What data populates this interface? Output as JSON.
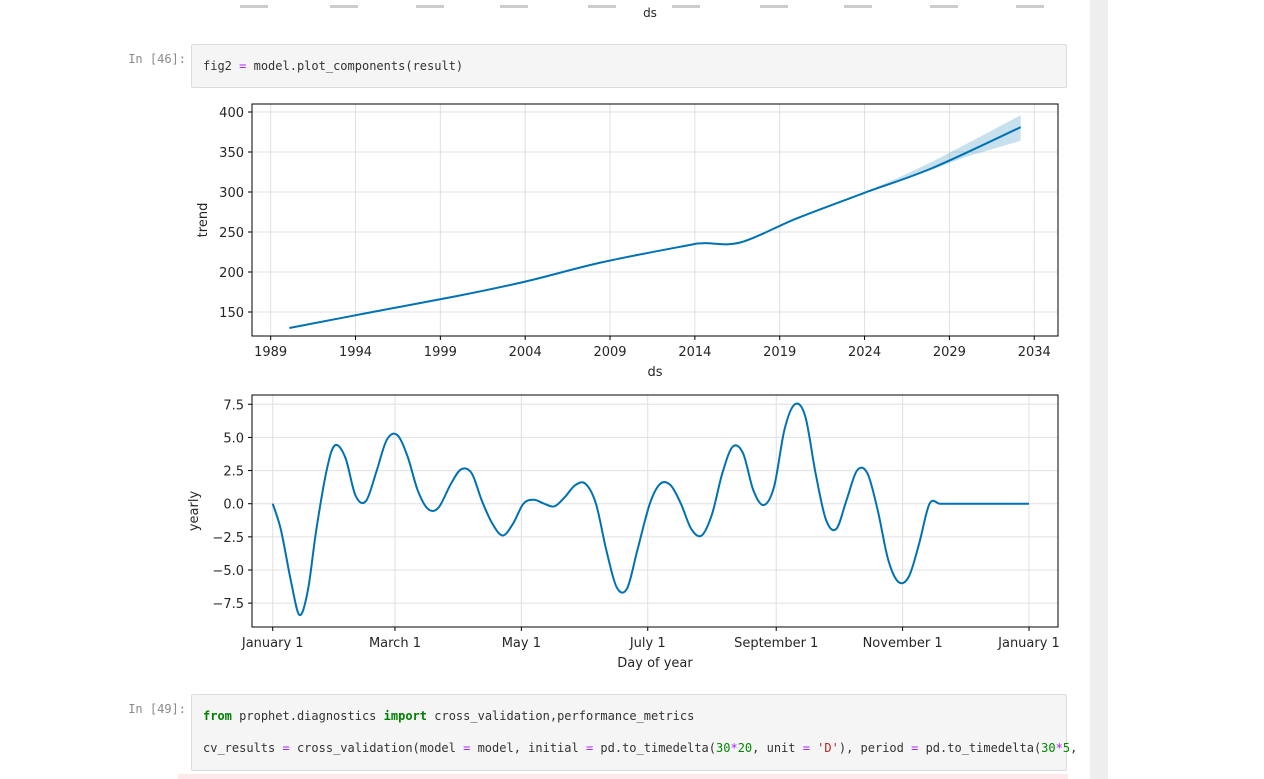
{
  "top_fragment": {
    "xlabel": "ds"
  },
  "cells": [
    {
      "prompt": "In [46]:",
      "code": {
        "var": "fig2",
        "eq": "=",
        "call": "model.plot_components",
        "paren_open": "(",
        "arg": "result",
        "paren_close": ")"
      }
    },
    {
      "prompt": "In [49]:",
      "line1": {
        "from": "from",
        "module": "prophet.diagnostics",
        "import": "import",
        "names": "cross_validation,performance_metrics"
      },
      "line2": {
        "t1": "cv_results ",
        "eq1": "=",
        "t2": " cross_validation(model ",
        "eq2": "=",
        "t3": " model, initial ",
        "eq3": "=",
        "t4": " pd.to_timedelta(",
        "n1": "30",
        "op1": "*",
        "n2": "20",
        "t5": ", unit ",
        "eq4": "=",
        "s1": " 'D'",
        "t6": "), period ",
        "eq5": "=",
        "t7": " pd.to_timedelta(",
        "n3": "30",
        "op2": "*",
        "n4": "5",
        "t8": ","
      }
    }
  ],
  "chart_data": [
    {
      "type": "line",
      "ylabel": "trend",
      "xlabel": "ds",
      "xlim": [
        1987.9,
        2035.4
      ],
      "ylim": [
        120,
        410
      ],
      "xticks": [
        1989,
        1994,
        1999,
        2004,
        2009,
        2014,
        2019,
        2024,
        2029,
        2034
      ],
      "yticks": [
        150,
        200,
        250,
        300,
        350,
        400
      ],
      "grid": true,
      "series": [
        {
          "color": "#0072B2",
          "x": [
            1990.1,
            1995,
            2000,
            2004,
            2008.5,
            2013.5,
            2014.5,
            2016.7,
            2020,
            2024,
            2028,
            2033.2
          ],
          "y": [
            130,
            150,
            170,
            188,
            212,
            233,
            236,
            237,
            267,
            299,
            330,
            381
          ]
        }
      ],
      "band": {
        "color": "#0072B2",
        "x": [
          2024,
          2026,
          2028,
          2030,
          2033.2
        ],
        "upper": [
          300,
          318,
          338,
          360,
          396
        ],
        "lower": [
          300,
          314,
          328,
          344,
          364
        ]
      }
    },
    {
      "type": "line",
      "ylabel": "yearly",
      "xlabel": "Day of year",
      "xlim": [
        -10,
        379
      ],
      "ylim": [
        -9.3,
        8.2
      ],
      "xtick_values": [
        0,
        59,
        120,
        181,
        243,
        304,
        365
      ],
      "xtick_labels": [
        "January 1",
        "March 1",
        "May 1",
        "July 1",
        "September 1",
        "November 1",
        "January 1"
      ],
      "yticks": [
        7.5,
        5.0,
        2.5,
        0.0,
        -2.5,
        -5.0,
        -7.5
      ],
      "ytick_labels": [
        "7.5",
        "5.0",
        "2.5",
        "0.0",
        "−2.5",
        "−5.0",
        "−7.5"
      ],
      "grid": true,
      "series": [
        {
          "color": "#0072B2",
          "x": [
            0,
            4,
            9,
            13,
            17,
            21,
            26,
            30,
            35,
            40,
            45,
            50,
            55,
            60,
            65,
            70,
            75,
            80,
            86,
            91,
            96,
            101,
            106,
            111,
            116,
            121,
            126,
            131,
            136,
            141,
            146,
            151,
            156,
            161,
            166,
            171,
            176,
            182,
            187,
            192,
            197,
            202,
            207,
            212,
            217,
            222,
            227,
            232,
            237,
            242,
            247,
            252,
            257,
            262,
            267,
            272,
            277,
            282,
            287,
            292,
            297,
            302,
            307,
            312,
            317,
            322,
            327,
            332,
            337,
            342,
            347,
            352,
            357,
            361,
            365
          ],
          "y": [
            0.0,
            -2.0,
            -6.0,
            -8.4,
            -6.5,
            -2.0,
            2.5,
            4.4,
            3.5,
            0.6,
            0.2,
            2.4,
            4.8,
            5.2,
            3.6,
            1.0,
            -0.4,
            -0.3,
            1.5,
            2.6,
            2.3,
            0.2,
            -1.5,
            -2.4,
            -1.5,
            0.0,
            0.3,
            0.0,
            -0.2,
            0.5,
            1.4,
            1.5,
            0.0,
            -3.5,
            -6.3,
            -6.4,
            -3.5,
            0.0,
            1.5,
            1.4,
            0.0,
            -1.9,
            -2.4,
            -0.8,
            2.3,
            4.3,
            3.8,
            1.0,
            -0.1,
            1.3,
            5.6,
            7.5,
            6.6,
            2.3,
            -1.2,
            -1.9,
            0.3,
            2.5,
            2.3,
            -0.5,
            -4.2,
            -5.9,
            -5.5,
            -3.0,
            0.0,
            0.0,
            0.0,
            0.0,
            0.0,
            0.0,
            0.0,
            0.0,
            0.0,
            0.0,
            0.0
          ]
        }
      ]
    }
  ]
}
